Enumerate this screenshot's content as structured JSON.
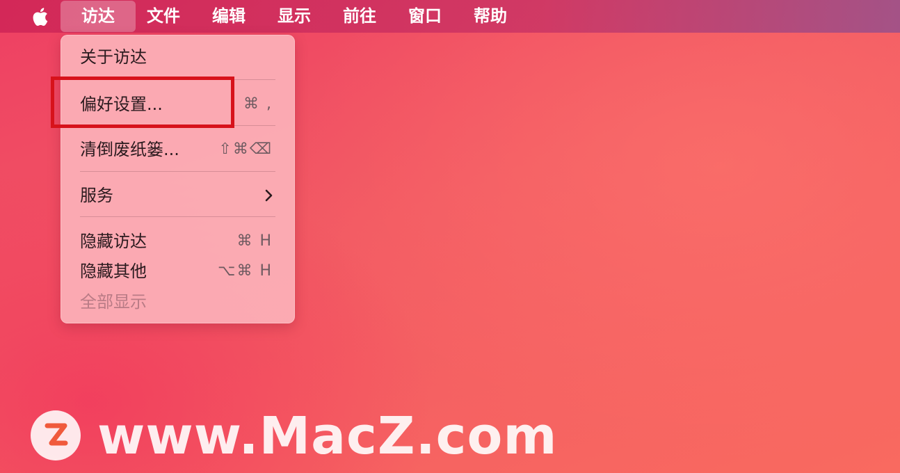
{
  "menubar": {
    "apple_icon": "apple-logo-icon",
    "items": [
      {
        "label": "访达"
      },
      {
        "label": "文件"
      },
      {
        "label": "编辑"
      },
      {
        "label": "显示"
      },
      {
        "label": "前往"
      },
      {
        "label": "窗口"
      },
      {
        "label": "帮助"
      }
    ]
  },
  "finder_menu": {
    "items": [
      {
        "label": "关于访达",
        "shortcut": ""
      },
      {
        "label": "偏好设置...",
        "shortcut": "⌘ ,"
      },
      {
        "label": "清倒废纸篓...",
        "shortcut": "⇧⌘⌫"
      },
      {
        "label": "服务",
        "submenu_icon": "chevron-right-icon"
      },
      {
        "label": "隐藏访达",
        "shortcut": "⌘ H"
      },
      {
        "label": "隐藏其他",
        "shortcut": "⌥⌘ H"
      },
      {
        "label": "全部显示",
        "shortcut": "",
        "disabled": true
      }
    ]
  },
  "annotation": {
    "color": "#d7121b"
  },
  "watermark": {
    "text": "www.MacZ.com",
    "logo_letter": "Z",
    "logo_color": "#f05a3c"
  },
  "colors": {
    "background": "#f25a63",
    "menu_background": "#fcb0b8"
  }
}
